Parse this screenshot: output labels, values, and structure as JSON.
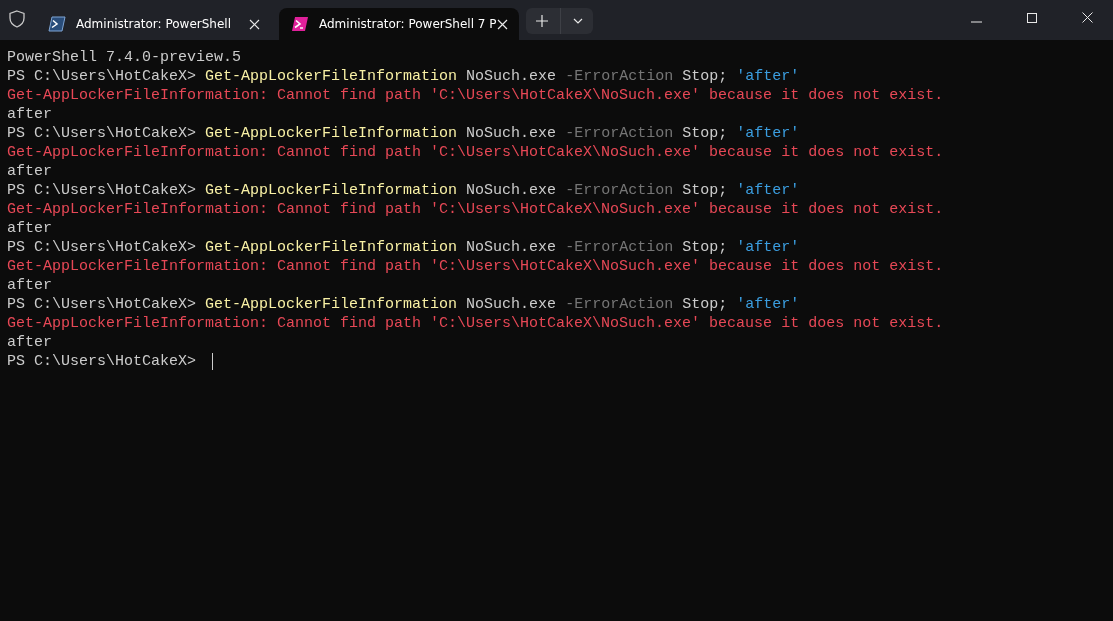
{
  "tabs": [
    {
      "title": "Administrator: PowerShell",
      "selected": false,
      "kind": "classic"
    },
    {
      "title": "Administrator: PowerShell 7 P",
      "selected": true,
      "kind": "core"
    }
  ],
  "terminal": {
    "lines": [
      [
        {
          "kind": "plain",
          "text": "PowerShell 7.4.0-preview.5"
        }
      ],
      [
        {
          "kind": "plain",
          "text": "PS C:\\Users\\HotCakeX> "
        },
        {
          "kind": "command",
          "text": "Get-AppLockerFileInformation"
        },
        {
          "kind": "plain",
          "text": " NoSuch.exe "
        },
        {
          "kind": "param",
          "text": "-ErrorAction"
        },
        {
          "kind": "plain",
          "text": " Stop; "
        },
        {
          "kind": "string",
          "text": "'after'"
        }
      ],
      [
        {
          "kind": "error",
          "text": "Get-AppLockerFileInformation: Cannot find path 'C:\\Users\\HotCakeX\\NoSuch.exe' because it does not exist."
        }
      ],
      [
        {
          "kind": "plain",
          "text": "after"
        }
      ],
      [
        {
          "kind": "plain",
          "text": "PS C:\\Users\\HotCakeX> "
        },
        {
          "kind": "command",
          "text": "Get-AppLockerFileInformation"
        },
        {
          "kind": "plain",
          "text": " NoSuch.exe "
        },
        {
          "kind": "param",
          "text": "-ErrorAction"
        },
        {
          "kind": "plain",
          "text": " Stop; "
        },
        {
          "kind": "string",
          "text": "'after'"
        }
      ],
      [
        {
          "kind": "error",
          "text": "Get-AppLockerFileInformation: Cannot find path 'C:\\Users\\HotCakeX\\NoSuch.exe' because it does not exist."
        }
      ],
      [
        {
          "kind": "plain",
          "text": "after"
        }
      ],
      [
        {
          "kind": "plain",
          "text": "PS C:\\Users\\HotCakeX> "
        },
        {
          "kind": "command",
          "text": "Get-AppLockerFileInformation"
        },
        {
          "kind": "plain",
          "text": " NoSuch.exe "
        },
        {
          "kind": "param",
          "text": "-ErrorAction"
        },
        {
          "kind": "plain",
          "text": " Stop; "
        },
        {
          "kind": "string",
          "text": "'after'"
        }
      ],
      [
        {
          "kind": "error",
          "text": "Get-AppLockerFileInformation: Cannot find path 'C:\\Users\\HotCakeX\\NoSuch.exe' because it does not exist."
        }
      ],
      [
        {
          "kind": "plain",
          "text": "after"
        }
      ],
      [
        {
          "kind": "plain",
          "text": "PS C:\\Users\\HotCakeX> "
        },
        {
          "kind": "command",
          "text": "Get-AppLockerFileInformation"
        },
        {
          "kind": "plain",
          "text": " NoSuch.exe "
        },
        {
          "kind": "param",
          "text": "-ErrorAction"
        },
        {
          "kind": "plain",
          "text": " Stop; "
        },
        {
          "kind": "string",
          "text": "'after'"
        }
      ],
      [
        {
          "kind": "error",
          "text": "Get-AppLockerFileInformation: Cannot find path 'C:\\Users\\HotCakeX\\NoSuch.exe' because it does not exist."
        }
      ],
      [
        {
          "kind": "plain",
          "text": "after"
        }
      ],
      [
        {
          "kind": "plain",
          "text": "PS C:\\Users\\HotCakeX> "
        },
        {
          "kind": "command",
          "text": "Get-AppLockerFileInformation"
        },
        {
          "kind": "plain",
          "text": " NoSuch.exe "
        },
        {
          "kind": "param",
          "text": "-ErrorAction"
        },
        {
          "kind": "plain",
          "text": " Stop; "
        },
        {
          "kind": "string",
          "text": "'after'"
        }
      ],
      [
        {
          "kind": "error",
          "text": "Get-AppLockerFileInformation: Cannot find path 'C:\\Users\\HotCakeX\\NoSuch.exe' because it does not exist."
        }
      ],
      [
        {
          "kind": "plain",
          "text": "after"
        }
      ],
      [
        {
          "kind": "plain",
          "text": "PS C:\\Users\\HotCakeX> "
        }
      ]
    ]
  }
}
